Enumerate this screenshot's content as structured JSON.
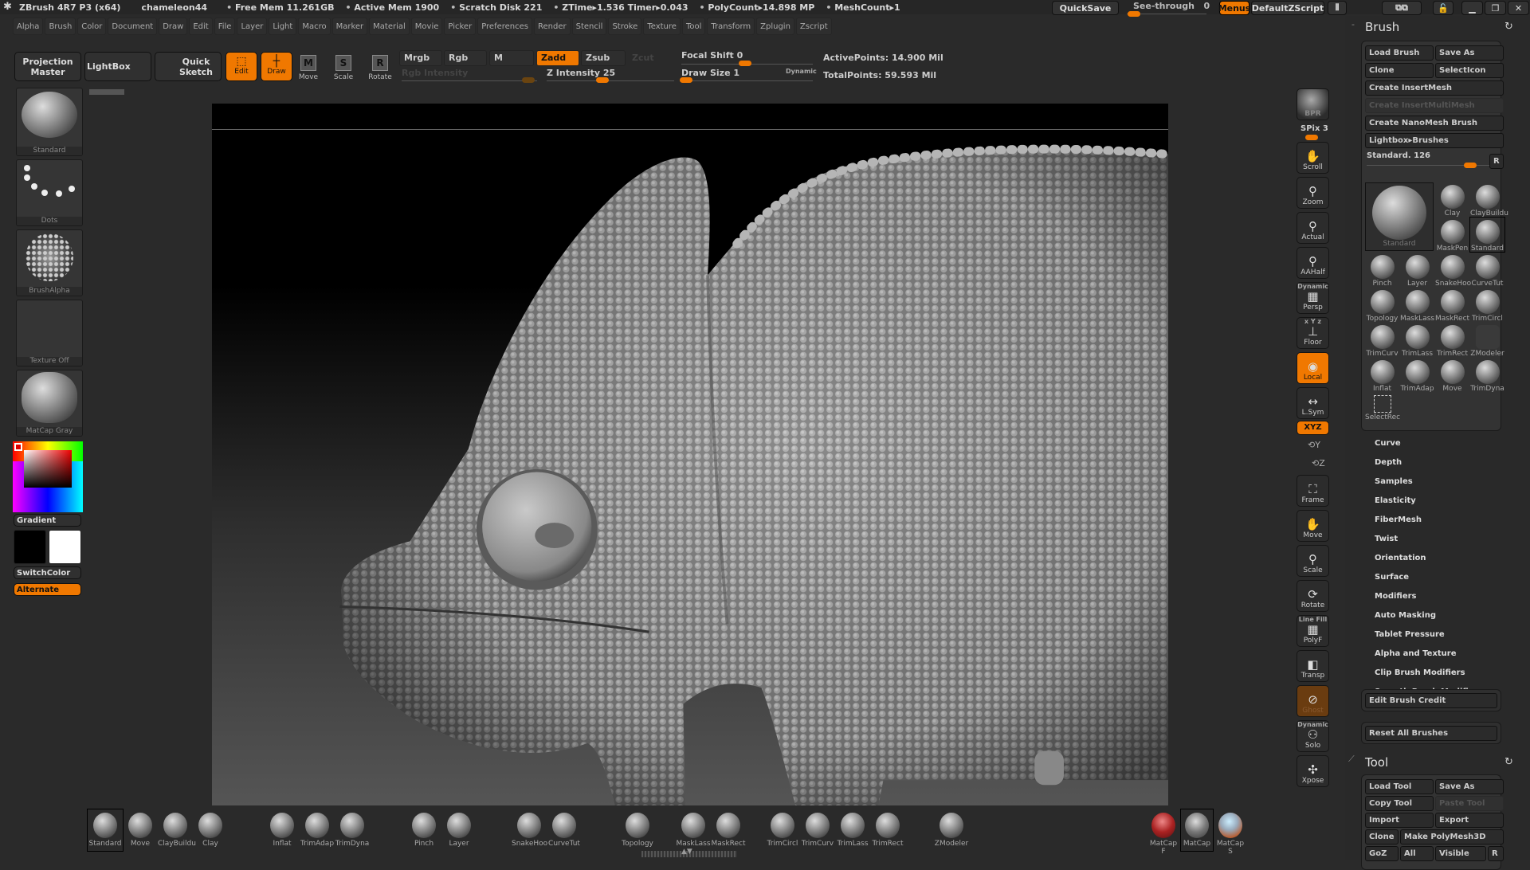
{
  "title_bar": {
    "app": "ZBrush 4R7 P3 (x64)",
    "document": "chameleon44",
    "stats": [
      "Free Mem 11.261GB",
      "Active Mem 1900",
      "Scratch Disk 221",
      "ZTime▸1.536 Timer▸0.043",
      "PolyCount▸14.898 MP",
      "MeshCount▸1"
    ],
    "quicksave": "QuickSave",
    "see_through": "See-through",
    "see_through_value": "0",
    "menus": "Menus",
    "default_zscript": "DefaultZScript"
  },
  "menu": [
    "Alpha",
    "Brush",
    "Color",
    "Document",
    "Draw",
    "Edit",
    "File",
    "Layer",
    "Light",
    "Macro",
    "Marker",
    "Material",
    "Movie",
    "Picker",
    "Preferences",
    "Render",
    "Stencil",
    "Stroke",
    "Texture",
    "Tool",
    "Transform",
    "Zplugin",
    "Zscript"
  ],
  "shelf": {
    "projection_master": "Projection Master",
    "lightbox": "LightBox",
    "quick_sketch": "Quick Sketch",
    "edit": "Edit",
    "draw": "Draw",
    "move": "Move",
    "scale": "Scale",
    "rotate": "Rotate",
    "mrgb": "Mrgb",
    "rgb": "Rgb",
    "m": "M",
    "zadd": "Zadd",
    "zsub": "Zsub",
    "zcut": "Zcut",
    "rgb_intensity": "Rgb Intensity",
    "z_intensity": "Z Intensity 25",
    "focal_shift": "Focal Shift 0",
    "draw_size": "Draw Size 1",
    "dynamic": "Dynamic",
    "active_points": "ActivePoints: 14.900 Mil",
    "total_points": "TotalPoints: 59.593 Mil",
    "z_intensity_value": 25,
    "focal_shift_value": 0,
    "draw_size_value": 1
  },
  "left_shelf": {
    "brush": "Standard",
    "stroke": "Dots",
    "alpha": "BrushAlpha",
    "texture": "Texture Off",
    "material": "MatCap Gray",
    "gradient": "Gradient",
    "switch_color": "SwitchColor",
    "alternate": "Alternate",
    "primary_color": "#000000",
    "secondary_color": "#ffffff"
  },
  "bottom_shelf": {
    "brushes": [
      "Standard",
      "Move",
      "ClayBuildu",
      "Clay",
      "Inflat",
      "TrimAdap",
      "TrimDyna",
      "Pinch",
      "Layer",
      "SnakeHoo",
      "CurveTut",
      "Topology",
      "MaskLass",
      "MaskRect",
      "TrimCircl",
      "TrimCurv",
      "TrimLass",
      "TrimRect",
      "ZModeler"
    ],
    "materials": [
      "MatCap F",
      "MatCap",
      "MatCap S"
    ]
  },
  "right_column": {
    "bpr": "BPR",
    "spix": "SPix 3",
    "buttons": [
      {
        "label": "Scroll",
        "icon": "hand-icon"
      },
      {
        "label": "Zoom",
        "icon": "zoom-icon"
      },
      {
        "label": "Actual",
        "icon": "actual-size-icon"
      },
      {
        "label": "AAHalf",
        "icon": "aahalf-icon"
      },
      {
        "label": "Persp",
        "icon": "perspective-icon",
        "sup": "Dynamic"
      },
      {
        "label": "Floor",
        "icon": "floor-icon",
        "sup": "x Y z"
      },
      {
        "label": "Local",
        "icon": "local-icon",
        "active": true
      },
      {
        "label": "L.Sym",
        "icon": "symmetry-icon"
      }
    ],
    "xyz": "XYZ",
    "y": "Y",
    "z": "Z",
    "buttons2": [
      {
        "label": "Frame",
        "icon": "frame-icon"
      },
      {
        "label": "Move",
        "icon": "move-icon"
      },
      {
        "label": "Scale",
        "icon": "scale-icon"
      },
      {
        "label": "Rotate",
        "icon": "rotate-icon"
      },
      {
        "label": "PolyF",
        "icon": "polyframe-icon",
        "sup": "Line Fill"
      },
      {
        "label": "Transp",
        "icon": "transparency-icon"
      },
      {
        "label": "Ghost",
        "icon": "ghost-icon",
        "ghost": true
      },
      {
        "label": "Solo",
        "icon": "solo-icon",
        "sup": "Dynamic"
      },
      {
        "label": "Xpose",
        "icon": "xpose-icon"
      }
    ]
  },
  "brush_palette": {
    "title": "Brush",
    "load": "Load Brush",
    "save_as": "Save As",
    "clone": "Clone",
    "select_icon": "SelectIcon",
    "create_insert": "Create InsertMesh",
    "create_insert_multi": "Create InsertMultiMesh",
    "create_nano": "Create NanoMesh Brush",
    "lightbox_brushes": "Lightbox▸Brushes",
    "current": "Standard. 126",
    "current_value": 126,
    "r": "R",
    "big": "Standard",
    "grid": [
      "Clay",
      "ClayBuildu",
      "MaskPen",
      "Standard",
      "Pinch",
      "Layer",
      "SnakeHoo",
      "CurveTut",
      "Topology",
      "MaskLass",
      "MaskRect",
      "TrimCircl",
      "TrimCurv",
      "TrimLass",
      "TrimRect",
      "ZModeler",
      "Inflat",
      "TrimAdap",
      "Move",
      "TrimDyna",
      "SelectRec"
    ],
    "subpalettes": [
      "Curve",
      "Depth",
      "Samples",
      "Elasticity",
      "FiberMesh",
      "Twist",
      "Orientation",
      "Surface",
      "Modifiers",
      "Auto Masking",
      "Tablet Pressure",
      "Alpha and Texture",
      "Clip Brush Modifiers",
      "Smooth Brush Modifiers"
    ],
    "edit_credit": "Edit Brush Credit",
    "reset_all": "Reset All Brushes"
  },
  "tool_palette": {
    "title": "Tool",
    "load": "Load Tool",
    "save_as": "Save As",
    "copy": "Copy Tool",
    "paste": "Paste Tool",
    "import": "Import",
    "export": "Export",
    "clone": "Clone",
    "make_polymesh": "Make PolyMesh3D",
    "goz": "GoZ",
    "all": "All",
    "visible": "Visible",
    "r": "R"
  },
  "colors": {
    "accent": "#f07800",
    "panel": "#292929",
    "canvas_top": "#000000",
    "canvas_bottom": "#555555"
  }
}
